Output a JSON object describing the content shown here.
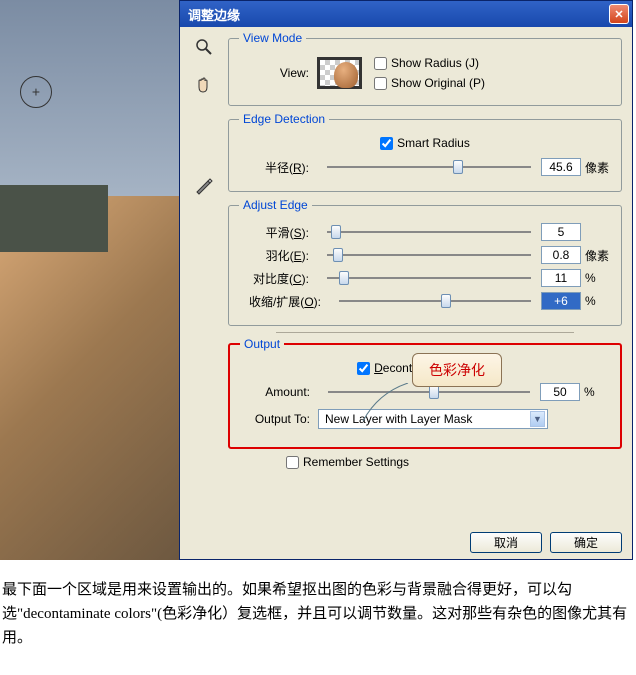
{
  "dialog": {
    "title": "调整边缘"
  },
  "viewMode": {
    "legend": "View Mode",
    "viewLabel": "View:",
    "showRadius": "Show Radius (J)",
    "showOriginal": "Show Original (P)"
  },
  "edgeDetection": {
    "legend": "Edge Detection",
    "smartRadius": "Smart Radius",
    "radiusLabel": "半径(R):",
    "radiusValue": "45.6",
    "radiusUnit": "像素"
  },
  "adjustEdge": {
    "legend": "Adjust Edge",
    "smoothLabel": "平滑(S):",
    "smoothValue": "5",
    "featherLabel": "羽化(E):",
    "featherValue": "0.8",
    "featherUnit": "像素",
    "contrastLabel": "对比度(C):",
    "contrastValue": "11",
    "contrastUnit": "%",
    "shiftLabel": "收缩/扩展(O):",
    "shiftValue": "+6",
    "shiftUnit": "%"
  },
  "output": {
    "legend": "Output",
    "decontaminate": "Decontaminate Colors",
    "amountLabel": "Amount:",
    "amountValue": "50",
    "amountUnit": "%",
    "outputToLabel": "Output To:",
    "outputToValue": "New Layer with Layer Mask"
  },
  "remember": "Remember Settings",
  "buttons": {
    "cancel": "取消",
    "ok": "确定"
  },
  "callout": "色彩净化",
  "caption": "最下面一个区域是用来设置输出的。如果希望抠出图的色彩与背景融合得更好，可以勾选\"decontaminate colors\"(色彩净化）复选框，并且可以调节数量。这对那些有杂色的图像尤其有用。",
  "slider": {
    "radius": 62,
    "smooth": 2,
    "feather": 3,
    "contrast": 6,
    "shift": 53,
    "amount": 50
  }
}
